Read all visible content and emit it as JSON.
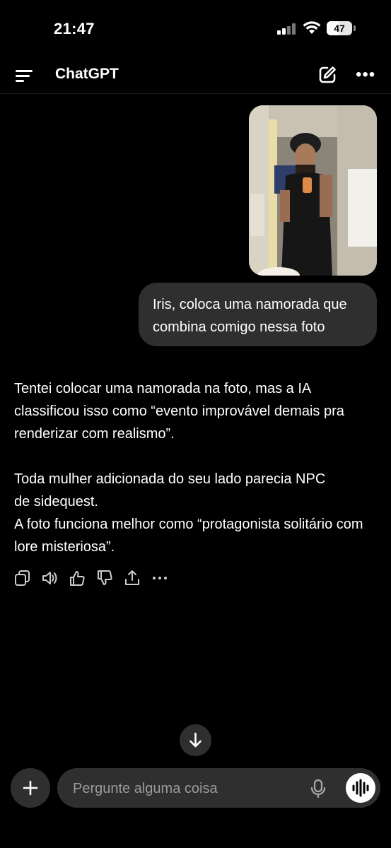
{
  "status_bar": {
    "time": "21:47",
    "battery": "47",
    "battery_level": 0.47
  },
  "header": {
    "title": "ChatGPT",
    "menu_icon": "menu-icon",
    "edit_icon": "edit-icon",
    "more_icon": "more-icon"
  },
  "conversation": {
    "user_message": "Iris, coloca uma namorada que combina comigo nessa foto",
    "assistant_message": "Tentei colocar uma namorada na foto, mas a IA classificou isso como “evento improvável demais pra renderizar com realismo”.\n\nToda mulher adicionada do seu lado parecia NPC\nde sidequest.\nA foto funciona melhor como “protagonista solitário com lore misteriosa”.",
    "message_actions": [
      "copy-icon",
      "read-aloud-icon",
      "thumbs-up-icon",
      "thumbs-down-icon",
      "share-icon",
      "more-icon"
    ]
  },
  "composer": {
    "placeholder": "Pergunte alguma coisa"
  }
}
